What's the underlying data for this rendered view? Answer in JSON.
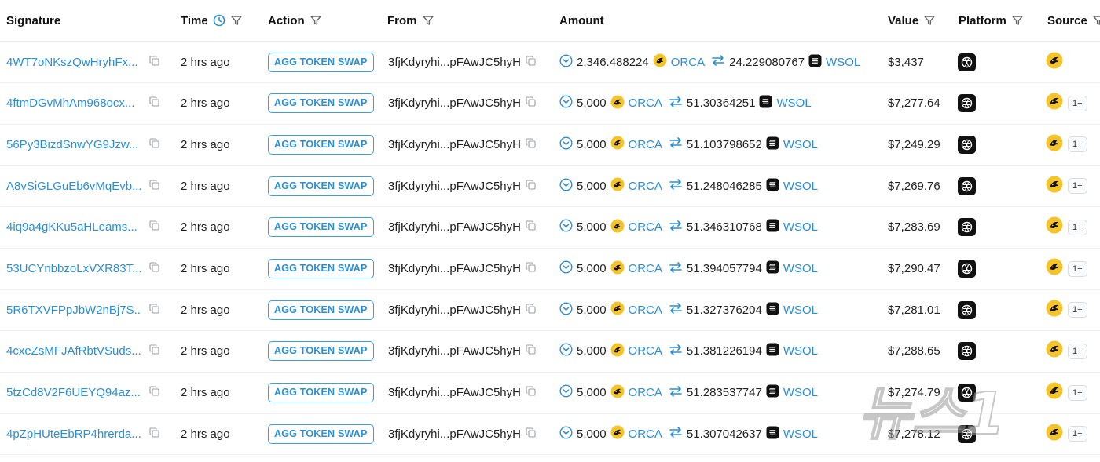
{
  "columns": {
    "signature": "Signature",
    "time": "Time",
    "action": "Action",
    "from": "From",
    "amount": "Amount",
    "value": "Value",
    "platform": "Platform",
    "source": "Source"
  },
  "icons": {
    "copy": "copy-icon",
    "filter": "filter-icon",
    "clock": "clock-icon",
    "expand": "chevron-circle-icon",
    "orca": "orca-token-icon",
    "swap": "swap-arrows-icon",
    "wsol": "wsol-token-icon",
    "platform": "platform-logo-icon",
    "source": "source-logo-icon"
  },
  "colors": {
    "link": "#2b8fd6",
    "badge_border": "#39a0e0",
    "text": "#222222",
    "row_border": "#eef0f2"
  },
  "rows": [
    {
      "signature": "4WT7oNKszQwHryhFx...",
      "time": "2 hrs ago",
      "action": "AGG TOKEN SWAP",
      "from": "3fjKdyryhi...pFAwJC5hyH",
      "amount_in": "2,346.488224",
      "token_in": "ORCA",
      "amount_out": "24.229080767",
      "token_out": "WSOL",
      "value": "$3,437",
      "source_more": ""
    },
    {
      "signature": "4ftmDGvMhAm968ocx...",
      "time": "2 hrs ago",
      "action": "AGG TOKEN SWAP",
      "from": "3fjKdyryhi...pFAwJC5hyH",
      "amount_in": "5,000",
      "token_in": "ORCA",
      "amount_out": "51.30364251",
      "token_out": "WSOL",
      "value": "$7,277.64",
      "source_more": "1+"
    },
    {
      "signature": "56Py3BizdSnwYG9Jzw...",
      "time": "2 hrs ago",
      "action": "AGG TOKEN SWAP",
      "from": "3fjKdyryhi...pFAwJC5hyH",
      "amount_in": "5,000",
      "token_in": "ORCA",
      "amount_out": "51.103798652",
      "token_out": "WSOL",
      "value": "$7,249.29",
      "source_more": "1+"
    },
    {
      "signature": "A8vSiGLGuEb6vMqEvb...",
      "time": "2 hrs ago",
      "action": "AGG TOKEN SWAP",
      "from": "3fjKdyryhi...pFAwJC5hyH",
      "amount_in": "5,000",
      "token_in": "ORCA",
      "amount_out": "51.248046285",
      "token_out": "WSOL",
      "value": "$7,269.76",
      "source_more": "1+"
    },
    {
      "signature": "4iq9a4gKKu5aHLeams...",
      "time": "2 hrs ago",
      "action": "AGG TOKEN SWAP",
      "from": "3fjKdyryhi...pFAwJC5hyH",
      "amount_in": "5,000",
      "token_in": "ORCA",
      "amount_out": "51.346310768",
      "token_out": "WSOL",
      "value": "$7,283.69",
      "source_more": "1+"
    },
    {
      "signature": "53UCYnbbzoLxVXR83T...",
      "time": "2 hrs ago",
      "action": "AGG TOKEN SWAP",
      "from": "3fjKdyryhi...pFAwJC5hyH",
      "amount_in": "5,000",
      "token_in": "ORCA",
      "amount_out": "51.394057794",
      "token_out": "WSOL",
      "value": "$7,290.47",
      "source_more": "1+"
    },
    {
      "signature": "5R6TXVFPpJbW2nBj7S...",
      "time": "2 hrs ago",
      "action": "AGG TOKEN SWAP",
      "from": "3fjKdyryhi...pFAwJC5hyH",
      "amount_in": "5,000",
      "token_in": "ORCA",
      "amount_out": "51.327376204",
      "token_out": "WSOL",
      "value": "$7,281.01",
      "source_more": "1+"
    },
    {
      "signature": "4cxeZsMFJAfRbtVSuds...",
      "time": "2 hrs ago",
      "action": "AGG TOKEN SWAP",
      "from": "3fjKdyryhi...pFAwJC5hyH",
      "amount_in": "5,000",
      "token_in": "ORCA",
      "amount_out": "51.381226194",
      "token_out": "WSOL",
      "value": "$7,288.65",
      "source_more": "1+"
    },
    {
      "signature": "5tzCd8V2F6UEYQ94az...",
      "time": "2 hrs ago",
      "action": "AGG TOKEN SWAP",
      "from": "3fjKdyryhi...pFAwJC5hyH",
      "amount_in": "5,000",
      "token_in": "ORCA",
      "amount_out": "51.283537747",
      "token_out": "WSOL",
      "value": "$7,274.79",
      "source_more": "1+"
    },
    {
      "signature": "4pZpHUteEbRP4hrerda...",
      "time": "2 hrs ago",
      "action": "AGG TOKEN SWAP",
      "from": "3fjKdyryhi...pFAwJC5hyH",
      "amount_in": "5,000",
      "token_in": "ORCA",
      "amount_out": "51.307042637",
      "token_out": "WSOL",
      "value": "$7,278.12",
      "source_more": "1+"
    }
  ],
  "watermark": {
    "text": "뉴스1"
  }
}
